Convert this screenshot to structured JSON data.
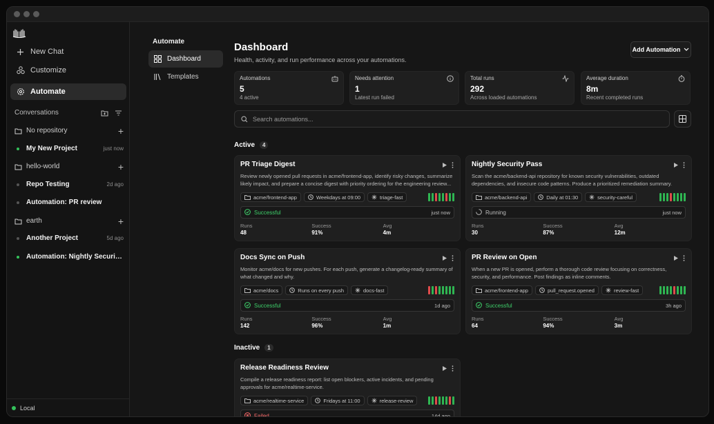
{
  "sidebar": {
    "nav": [
      {
        "label": "New Chat",
        "icon": "plus-icon"
      },
      {
        "label": "Customize",
        "icon": "puzzle-icon"
      },
      {
        "label": "Automate",
        "icon": "gear-icon"
      }
    ],
    "conversations_label": "Conversations",
    "groups": [
      {
        "name": "No repository",
        "items": [
          {
            "title": "My New Project",
            "time": "just now",
            "live": true
          }
        ]
      },
      {
        "name": "hello-world",
        "items": [
          {
            "title": "Repo Testing",
            "time": "2d ago",
            "live": false
          },
          {
            "title": "Automation: PR review",
            "time": "",
            "live": false
          }
        ]
      },
      {
        "name": "earth",
        "items": [
          {
            "title": "Another Project",
            "time": "5d ago",
            "live": false
          },
          {
            "title": "Automation: Nightly Security Pa...",
            "time": "",
            "live": true
          }
        ]
      }
    ],
    "footer": "Local"
  },
  "subnav": {
    "title": "Automate",
    "items": [
      {
        "label": "Dashboard"
      },
      {
        "label": "Templates"
      }
    ]
  },
  "header": {
    "title": "Dashboard",
    "subtitle": "Health, activity, and run performance across your automations.",
    "add_button": "Add Automation"
  },
  "stats": [
    {
      "label": "Automations",
      "value": "5",
      "sub": "4 active"
    },
    {
      "label": "Needs attention",
      "value": "1",
      "sub": "Latest run failed"
    },
    {
      "label": "Total runs",
      "value": "292",
      "sub": "Across loaded automations"
    },
    {
      "label": "Average duration",
      "value": "8m",
      "sub": "Recent completed runs"
    }
  ],
  "search": {
    "placeholder": "Search automations..."
  },
  "sections": {
    "active": {
      "label": "Active",
      "count": "4"
    },
    "inactive": {
      "label": "Inactive",
      "count": "1"
    }
  },
  "metric_labels": {
    "runs": "Runs",
    "success": "Success",
    "avg": "Avg"
  },
  "cards": [
    {
      "title": "PR Triage Digest",
      "desc": "Review newly opened pull requests in acme/frontend-app, identify risky changes, summarize likely impact, and prepare a concise digest with priority ordering for the engineering review...",
      "repo": "acme/frontend-app",
      "schedule": "Weekdays at 09:00",
      "profile": "triage-fast",
      "history": [
        "s",
        "s",
        "f",
        "s",
        "s",
        "f",
        "s",
        "s"
      ],
      "status": "Successful",
      "status_kind": "ok",
      "time": "just now",
      "runs": "48",
      "success": "91%",
      "avg": "4m"
    },
    {
      "title": "Nightly Security Pass",
      "desc": "Scan the acme/backend-api repository for known security vulnerabilities, outdated dependencies, and insecure code patterns. Produce a prioritized remediation summary.",
      "repo": "acme/backend-api",
      "schedule": "Daily at 01:30",
      "profile": "security-careful",
      "history": [
        "s",
        "s",
        "s",
        "f",
        "s",
        "s",
        "s",
        "s"
      ],
      "status": "Running",
      "status_kind": "run",
      "time": "just now",
      "runs": "30",
      "success": "87%",
      "avg": "12m"
    },
    {
      "title": "Docs Sync on Push",
      "desc": "Monitor acme/docs for new pushes. For each push, generate a changelog-ready summary of what changed and why.",
      "repo": "acme/docs",
      "schedule": "Runs on every push",
      "profile": "docs-fast",
      "history": [
        "f",
        "s",
        "f",
        "s",
        "s",
        "s",
        "s",
        "s"
      ],
      "status": "Successful",
      "status_kind": "ok",
      "time": "1d ago",
      "runs": "142",
      "success": "96%",
      "avg": "1m"
    },
    {
      "title": "PR Review on Open",
      "desc": "When a new PR is opened, perform a thorough code review focusing on correctness, security, and performance. Post findings as inline comments.",
      "repo": "acme/frontend-app",
      "schedule": "pull_request.opened",
      "profile": "review-fast",
      "history": [
        "s",
        "s",
        "s",
        "s",
        "f",
        "s",
        "s",
        "s"
      ],
      "status": "Successful",
      "status_kind": "ok",
      "time": "3h ago",
      "runs": "64",
      "success": "94%",
      "avg": "3m"
    },
    {
      "title": "Release Readiness Review",
      "desc": "Compile a release readiness report: list open blockers, active incidents, and pending approvals for acme/realtime-service.",
      "repo": "acme/realtime-service",
      "schedule": "Fridays at 11:00",
      "profile": "release-review",
      "history": [
        "s",
        "s",
        "f",
        "s",
        "s",
        "s",
        "f",
        "s"
      ],
      "status": "Failed",
      "status_kind": "bad",
      "time": "14d ago",
      "runs": "",
      "success": "",
      "avg": ""
    }
  ]
}
